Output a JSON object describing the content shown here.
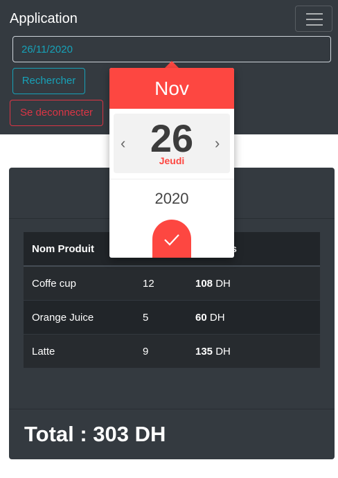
{
  "app": {
    "title": "Application"
  },
  "nav": {
    "menu_icon": "hamburger-menu-icon"
  },
  "search": {
    "date_value": "26/11/2020",
    "search_label": "Rechercher"
  },
  "auth": {
    "logout_label": "Se deconnecter"
  },
  "table": {
    "headers": [
      "Nom Produit",
      "",
      "produits"
    ],
    "rows": [
      {
        "name": "Coffe cup",
        "qty": "12",
        "total": "108",
        "currency": "DH"
      },
      {
        "name": "Orange Juice",
        "qty": "5",
        "total": "60",
        "currency": "DH"
      },
      {
        "name": "Latte",
        "qty": "9",
        "total": "135",
        "currency": "DH"
      }
    ]
  },
  "summary": {
    "total_text": "Total : 303 DH"
  },
  "datepicker": {
    "month": "Nov",
    "day": "26",
    "weekday": "Jeudi",
    "year": "2020",
    "prev_icon": "chevron-left-icon",
    "next_icon": "chevron-right-icon",
    "confirm_icon": "checkmark-icon",
    "accent": "#fd4741"
  },
  "colors": {
    "navbar_bg": "#343a40",
    "info": "#17a2b8",
    "danger": "#dc3545"
  }
}
